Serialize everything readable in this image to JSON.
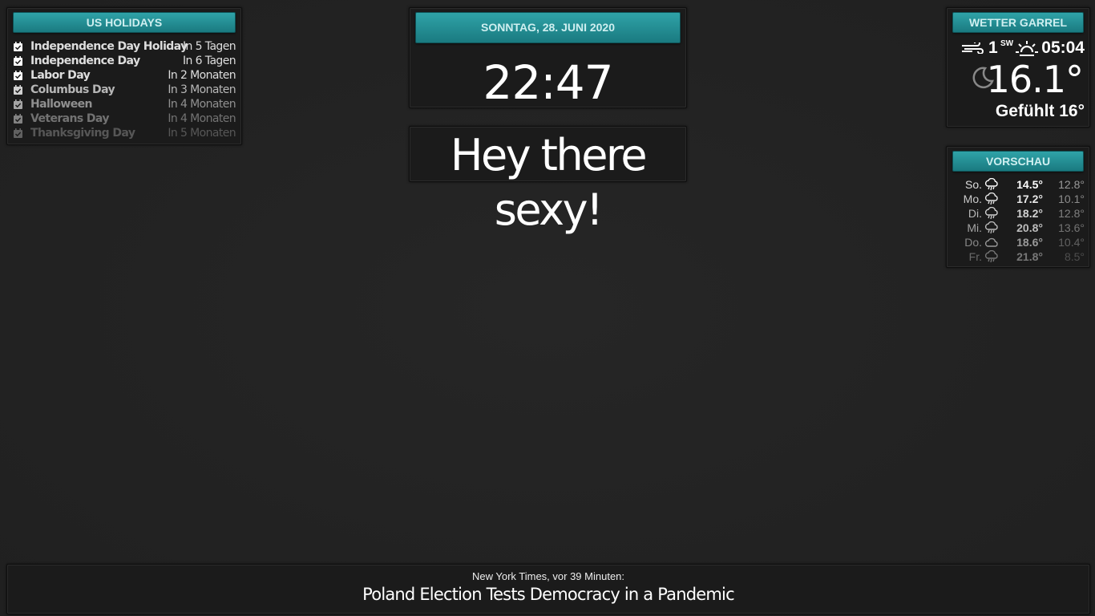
{
  "holidays": {
    "title": "US HOLIDAYS",
    "items": [
      {
        "name": "Independence Day Holiday",
        "when": "In 5 Tagen",
        "opacity": 1.0
      },
      {
        "name": "Independence Day",
        "when": "In 6 Tagen",
        "opacity": 1.0
      },
      {
        "name": "Labor Day",
        "when": "In 2 Monaten",
        "opacity": 1.0
      },
      {
        "name": "Columbus Day",
        "when": "In 3 Monaten",
        "opacity": 0.8
      },
      {
        "name": "Halloween",
        "when": "In 4 Monaten",
        "opacity": 0.6
      },
      {
        "name": "Veterans Day",
        "when": "In 4 Monaten",
        "opacity": 0.45
      },
      {
        "name": "Thanksgiving Day",
        "when": "In 5 Monaten",
        "opacity": 0.3
      }
    ]
  },
  "clock": {
    "date": "SONNTAG, 28. JUNI 2020",
    "time": "22:47"
  },
  "compliment": {
    "text": "Hey there sexy!"
  },
  "weather": {
    "title": "WETTER GARREL",
    "wind_speed": "1",
    "wind_direction": "SW",
    "sunrise": "05:04",
    "temperature": "16.1°",
    "feels_like": "Gefühlt 16°",
    "icons": {
      "wind": "wind-icon",
      "sun": "sunrise-icon",
      "condition": "moon-icon"
    }
  },
  "forecast": {
    "title": "VORSCHAU",
    "days": [
      {
        "day": "So.",
        "hi": "14.5°",
        "lo": "12.8°",
        "icon": "rain-cloud-icon",
        "opacity": 1.0
      },
      {
        "day": "Mo.",
        "hi": "17.2°",
        "lo": "10.1°",
        "icon": "rain-cloud-icon",
        "opacity": 0.9
      },
      {
        "day": "Di.",
        "hi": "18.2°",
        "lo": "12.8°",
        "icon": "rain-cloud-icon",
        "opacity": 0.8
      },
      {
        "day": "Mi.",
        "hi": "20.8°",
        "lo": "13.6°",
        "icon": "rain-cloud-icon",
        "opacity": 0.7
      },
      {
        "day": "Do.",
        "hi": "18.6°",
        "lo": "10.4°",
        "icon": "cloud-icon",
        "opacity": 0.55
      },
      {
        "day": "Fr.",
        "hi": "21.8°",
        "lo": "8.5°",
        "icon": "rain-cloud-icon",
        "opacity": 0.4
      }
    ]
  },
  "news": {
    "source": "New York Times, vor 39 Minuten:",
    "headline": "Poland Election Tests Democracy in a Pandemic"
  },
  "colors": {
    "accent": "#2a9499",
    "background": "#232323",
    "panel": "#1b1b1b"
  }
}
